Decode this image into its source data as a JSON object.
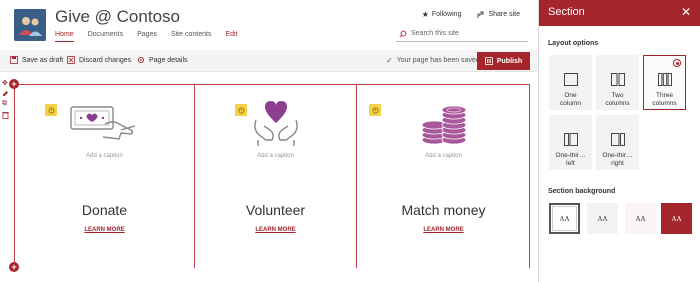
{
  "site": {
    "title": "Give @ Contoso",
    "nav": [
      "Home",
      "Documents",
      "Pages",
      "Site contents",
      "Edit"
    ],
    "actions": {
      "following": "Following",
      "share": "Share site"
    },
    "search_placeholder": "Search this site"
  },
  "command_bar": {
    "save_draft": "Save as draft",
    "discard": "Discard changes",
    "page_details": "Page details",
    "saved_status": "Your page has been saved",
    "publish": "Publish"
  },
  "columns": [
    {
      "caption": "Add a caption",
      "heading": "Donate",
      "link": "LEARN MORE",
      "image": "donate-hand-money-icon"
    },
    {
      "caption": "Add a caption",
      "heading": "Volunteer",
      "link": "LEARN MORE",
      "image": "hands-heart-icon"
    },
    {
      "caption": "Add a caption",
      "heading": "Match money",
      "link": "LEARN MORE",
      "image": "coin-stack-icon"
    }
  ],
  "panel": {
    "title": "Section",
    "layout_label": "Layout options",
    "layouts": [
      {
        "line1": "One",
        "line2": "column",
        "selected": false
      },
      {
        "line1": "Two",
        "line2": "columns",
        "selected": false
      },
      {
        "line1": "Three",
        "line2": "columns",
        "selected": true
      },
      {
        "line1": "One-thir…",
        "line2": "left",
        "selected": false
      },
      {
        "line1": "One-thir…",
        "line2": "right",
        "selected": false
      }
    ],
    "background_label": "Section background",
    "swatch_text": "AA",
    "swatches": [
      "#ffffff",
      "#f3f3f3",
      "#faf4f4",
      "#a4262c"
    ]
  },
  "colors": {
    "accent": "#a4262c",
    "badge": "#f6d047",
    "coin": "#a8579a"
  }
}
